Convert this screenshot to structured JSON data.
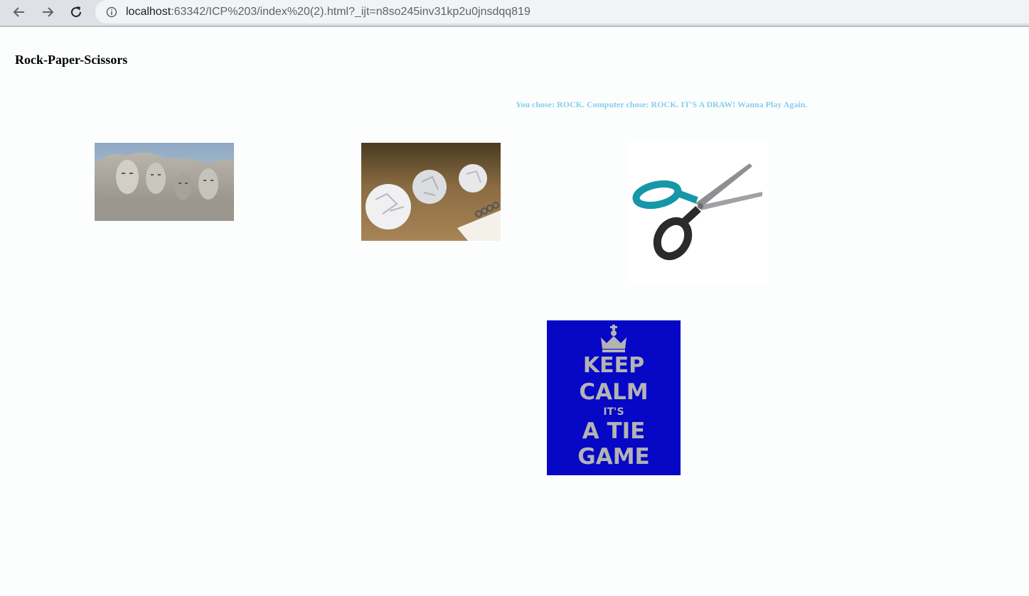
{
  "browser": {
    "url_host": "localhost",
    "url_rest": ":63342/ICP%203/index%20(2).html?_ijt=n8so245inv31kp2u0jnsdqq819",
    "icons": {
      "back": "arrow-left-icon",
      "forward": "arrow-right-icon",
      "reload": "reload-icon",
      "info": "info-icon"
    }
  },
  "page": {
    "title": "Rock-Paper-Scissors",
    "result": "You chose: ROCK. Computer chose: ROCK. IT'S A DRAW! Wanna Play Again.",
    "result_color": "#87ceeb",
    "background": "#fcfefe"
  },
  "choices": [
    {
      "id": "rock",
      "image": "mount-rushmore-rock-image"
    },
    {
      "id": "paper",
      "image": "crumpled-paper-image"
    },
    {
      "id": "scissors",
      "image": "scissors-image"
    }
  ],
  "tie_poster": {
    "lines": [
      "KEEP",
      "CALM",
      "IT'S",
      "A TIE",
      "GAME"
    ],
    "background": "#0707c6",
    "text_color": "#b3b3b3"
  }
}
